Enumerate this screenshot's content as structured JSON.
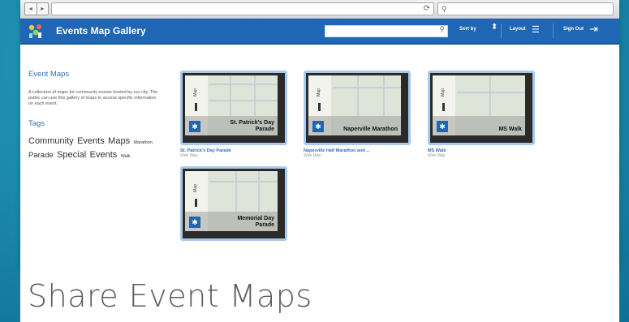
{
  "browser": {
    "nav_back": "◂",
    "nav_fwd": "▸"
  },
  "header": {
    "title": "Events Map Gallery",
    "search_placeholder": "",
    "sort_label": "Sort by",
    "layout_label": "Layout",
    "signout_label": "Sign Out"
  },
  "sidebar": {
    "heading": "Event Maps",
    "description": "A collection of maps for community events hosted by our city. The public can use this gallery of maps to access specific information on each event.",
    "tags_heading": "Tags",
    "tags": [
      {
        "label": "Community",
        "size": "lg"
      },
      {
        "label": "Events",
        "size": "lg"
      },
      {
        "label": "Maps",
        "size": "lg"
      },
      {
        "label": "Marathon",
        "size": "sm"
      },
      {
        "label": "Parade",
        "size": "md"
      },
      {
        "label": "Special",
        "size": "lg"
      },
      {
        "label": "Events",
        "size": "lg"
      },
      {
        "label": "Walk",
        "size": "sm"
      }
    ]
  },
  "gallery": [
    {
      "thumb_label": "St. Patrick's Day Parade",
      "title": "St. Patrick's Day Parade",
      "type": "Web Map"
    },
    {
      "thumb_label": "Naperville Marathon",
      "title": "Naperville Half Marathon and ...",
      "type": "Web Map"
    },
    {
      "thumb_label": "MS Walk",
      "title": "MS Walk",
      "type": "Web Map"
    },
    {
      "thumb_label": "Memorial Day Parade",
      "title": "",
      "type": ""
    }
  ],
  "caption": "Share Event Maps",
  "colors": {
    "appbar": "#1f67b4",
    "link": "#2d6fb8",
    "thumb_border": "#a9c9ec"
  }
}
